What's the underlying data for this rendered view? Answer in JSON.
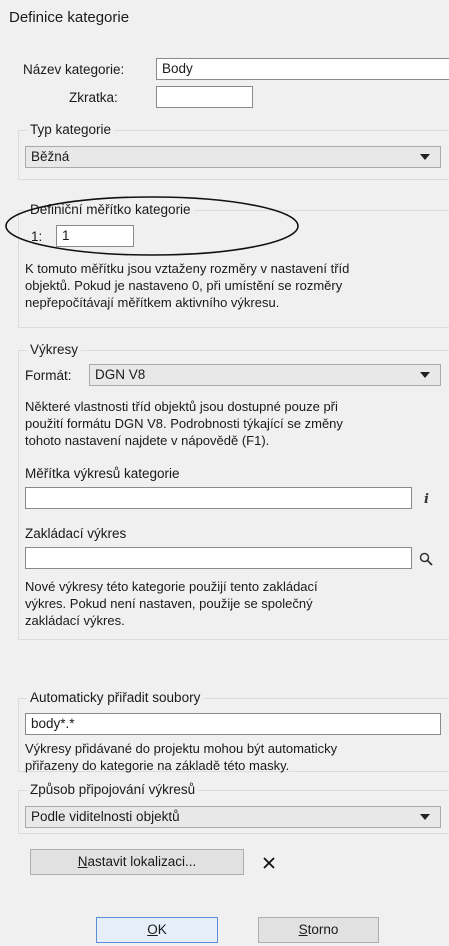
{
  "dialog": {
    "title": "Definice kategorie"
  },
  "name": {
    "label": "Název kategorie:",
    "value": "Body"
  },
  "abbrev": {
    "label": "Zkratka:",
    "value": ""
  },
  "type": {
    "legend": "Typ kategorie",
    "selected": "Běžná"
  },
  "scale": {
    "legend": "Definiční měřítko kategorie",
    "prefix": "1:",
    "value": "1",
    "desc": [
      "K tomuto měřítku jsou vztaženy rozměry v nastavení tříd",
      "objektů. Pokud je nastaveno 0, při umístění se rozměry",
      "nepřepočítávají měřítkem aktivního výkresu."
    ]
  },
  "drawings": {
    "legend": "Výkresy",
    "format_label": "Formát:",
    "format_value": "DGN V8",
    "desc": [
      "Některé vlastnosti tříd objektů jsou dostupné pouze při",
      "použití formátu DGN V8. Podrobnosti týkající se změny",
      "tohoto nastavení najdete v nápovědě (F1)."
    ],
    "scales_label": "Měřítka výkresů kategorie",
    "scales_value": "",
    "seed_label": "Zakládací výkres",
    "seed_value": "",
    "seed_desc": [
      "Nové výkresy této kategorie použijí tento zakládací",
      "výkres. Pokud není nastaven, použije se společný",
      "zakládací výkres."
    ]
  },
  "auto": {
    "legend": "Automaticky přiřadit soubory",
    "value": "body*.*",
    "desc": [
      "Výkresy přidávané do projektu mohou být automaticky",
      "přiřazeny do kategorie na základě této masky."
    ]
  },
  "attach": {
    "legend": "Způsob připojování výkresů",
    "selected": "Podle viditelnosti objektů"
  },
  "buttons": {
    "localize_mnemonic": "N",
    "localize_rest": "astavit lokalizaci...",
    "ok_mnemonic": "O",
    "ok_rest": "K",
    "cancel_mnemonic": "S",
    "cancel_rest": "torno"
  }
}
